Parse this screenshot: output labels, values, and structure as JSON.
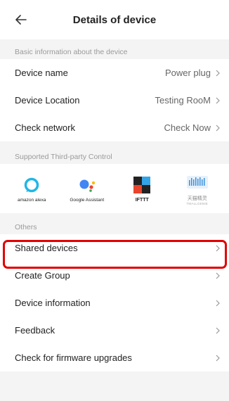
{
  "header": {
    "title": "Details of device"
  },
  "basic": {
    "section_label": "Basic information about the device",
    "rows": [
      {
        "label": "Device name",
        "value": "Power plug"
      },
      {
        "label": "Device Location",
        "value": "Testing RooM"
      },
      {
        "label": "Check network",
        "value": "Check Now"
      }
    ]
  },
  "third_party": {
    "section_label": "Supported Third-party Control",
    "items": [
      {
        "caption": "amazon alexa",
        "icon": "alexa-icon",
        "color": "#1fb7e6"
      },
      {
        "caption": "Google Assistant",
        "icon": "google-assistant-icon"
      },
      {
        "caption": "IFTTT",
        "icon": "ifttt-icon"
      },
      {
        "caption": "天猫精灵",
        "sub_caption": "TMALLGENIE",
        "icon": "tmall-genie-icon",
        "color": "#3a8fd8"
      }
    ]
  },
  "others": {
    "section_label": "Others",
    "rows": [
      {
        "label": "Shared devices"
      },
      {
        "label": "Create Group"
      },
      {
        "label": "Device information"
      },
      {
        "label": "Feedback"
      },
      {
        "label": "Check for firmware upgrades"
      }
    ]
  },
  "colors": {
    "highlight": "#e10000",
    "background": "#f4f4f4"
  }
}
